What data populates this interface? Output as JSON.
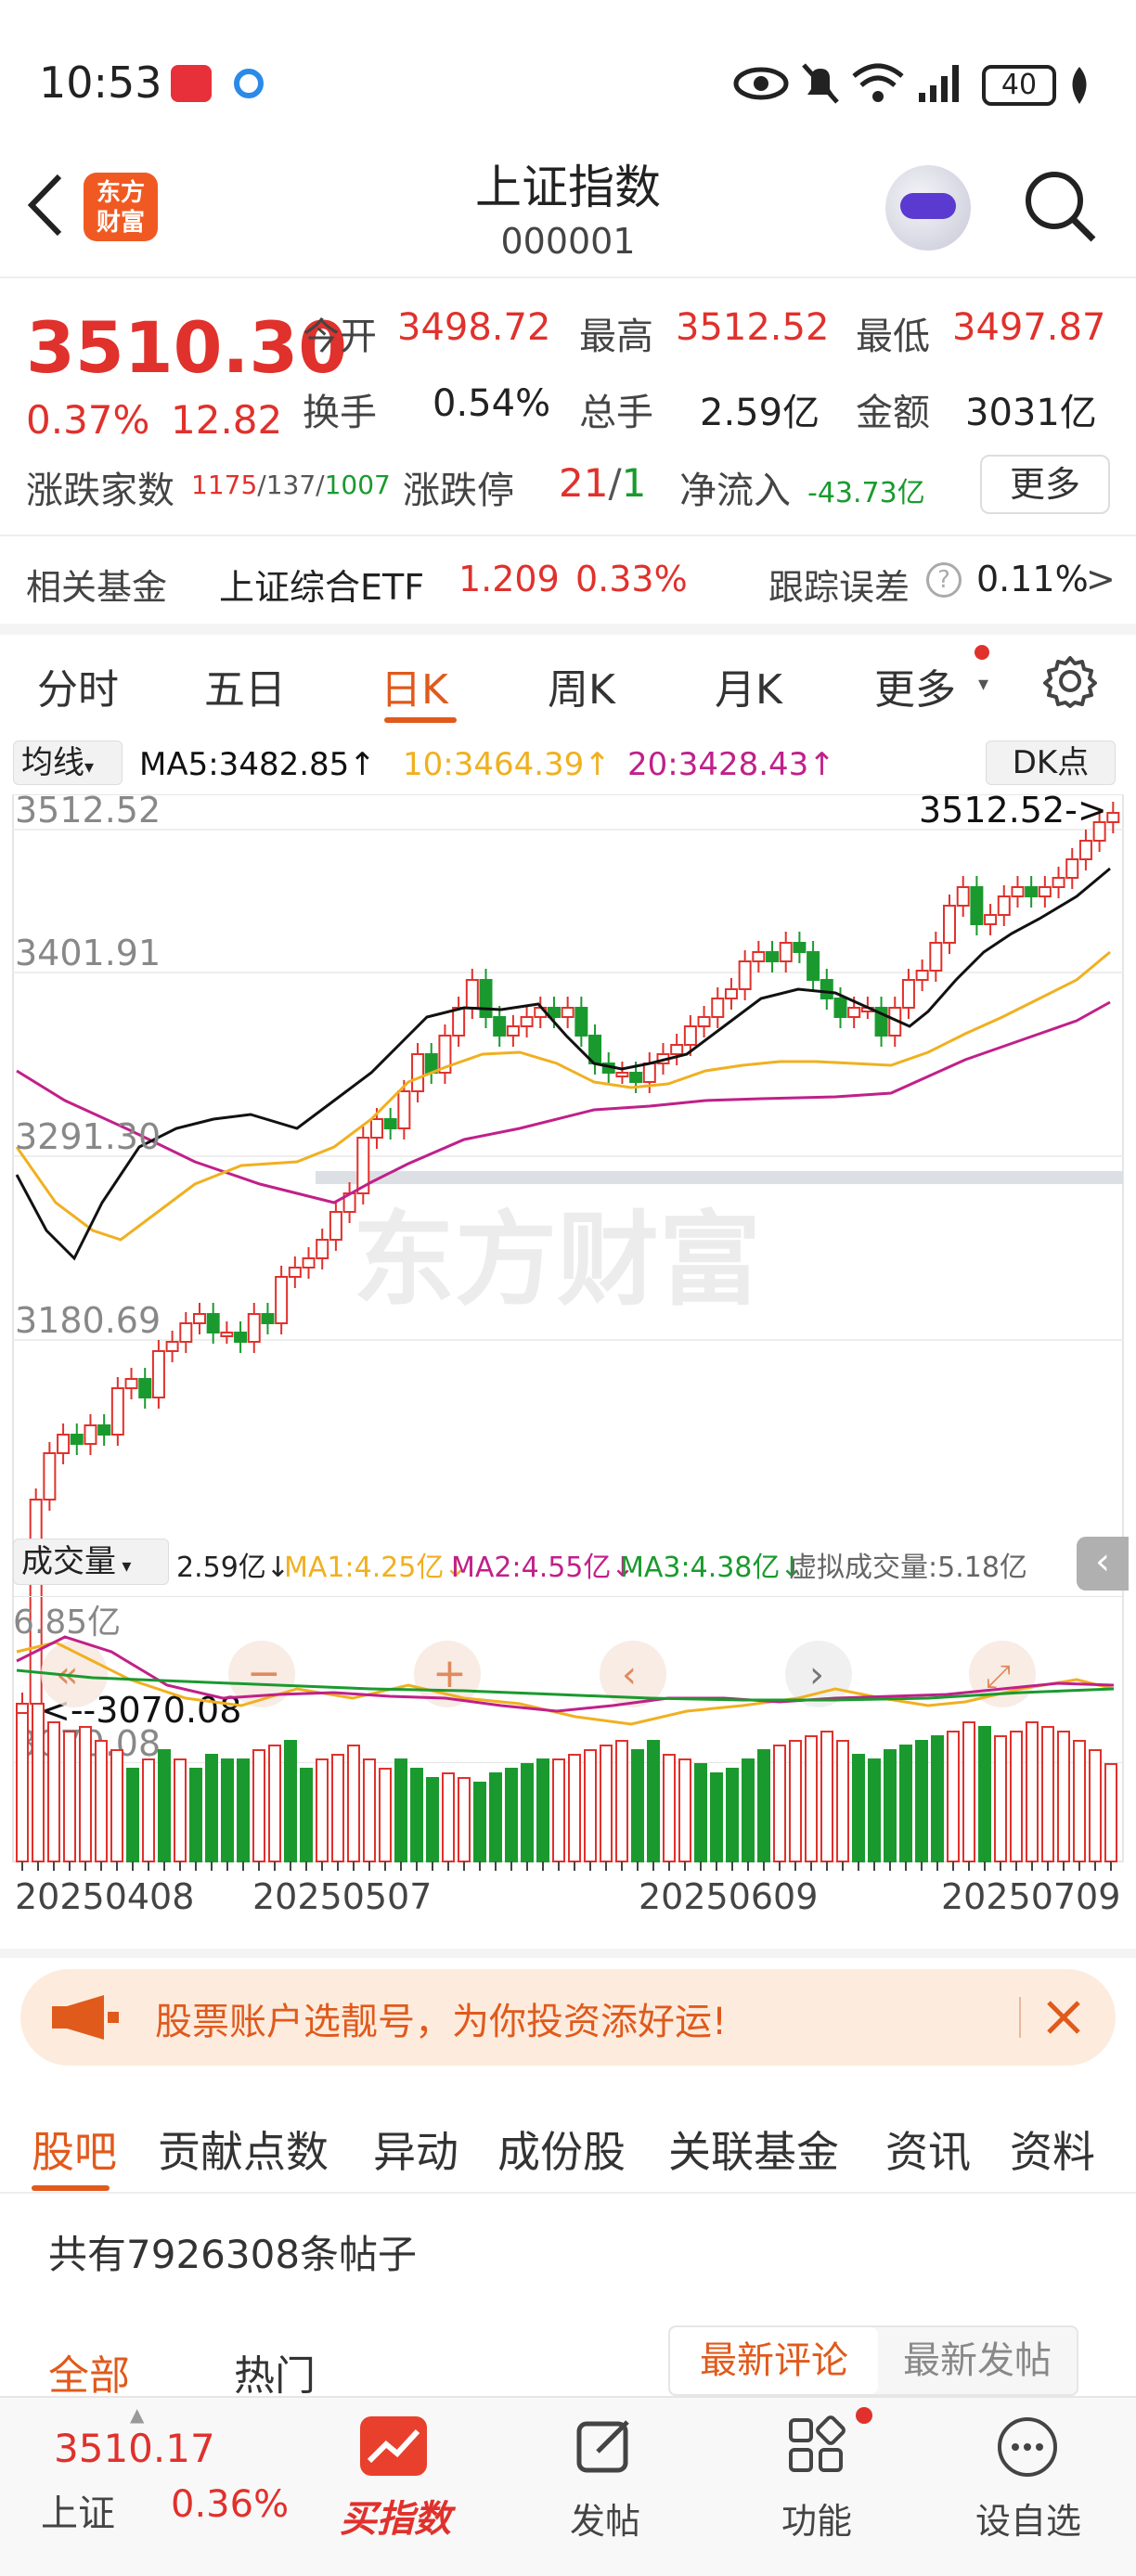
{
  "status_bar": {
    "time": "10:53",
    "battery": "40"
  },
  "header": {
    "title": "上证指数",
    "code": "000001",
    "logo_text": "东方财富"
  },
  "quote": {
    "price": "3510.30",
    "change_pct": "0.37%",
    "change_val": "12.82",
    "open_label": "今开",
    "open": "3498.72",
    "high_label": "最高",
    "high": "3512.52",
    "low_label": "最低",
    "low": "3497.87",
    "turnover_label": "换手",
    "turnover": "0.54%",
    "volume_label": "总手",
    "volume": "2.59亿",
    "amount_label": "金额",
    "amount": "3031亿",
    "breadth_label": "涨跌家数",
    "breadth_up": "1175",
    "breadth_flat": "137",
    "breadth_down": "1007",
    "limit_label": "涨跌停",
    "limit_up": "21",
    "limit_down": "1",
    "netflow_label": "净流入",
    "netflow": "-43.73亿",
    "more": "更多"
  },
  "fund": {
    "label": "相关基金",
    "name": "上证综合ETF",
    "price": "1.209",
    "pct": "0.33%",
    "tracking_label": "跟踪误差",
    "tracking": "0.11%",
    "arrow": ">"
  },
  "period_tabs": [
    "分时",
    "五日",
    "日K",
    "周K",
    "月K",
    "更多"
  ],
  "kline": {
    "ma_select": "均线",
    "ma5": "MA5:3482.85↑",
    "ma10": "10:3464.39↑",
    "ma20": "20:3428.43↑",
    "dk": "DK点",
    "y_labels": [
      "3512.52",
      "3401.91",
      "3291.30",
      "3180.69",
      "3070.08"
    ],
    "high_marker": "3512.52->",
    "low_marker": "<--3070.08",
    "watermark": "东方财富"
  },
  "volume": {
    "select": "成交量",
    "value": "2.59亿↓",
    "ma1": "MA1:4.25亿↓",
    "ma2": "MA2:4.55亿↓",
    "ma3": "MA3:4.38亿↓",
    "virtual": "虚拟成交量:5.18亿",
    "max_label": "6.85亿",
    "dates": [
      "20250408",
      "20250507",
      "20250609",
      "20250709"
    ]
  },
  "banner": {
    "text": "股票账户选靓号，为你投资添好运!"
  },
  "bottom_tabs": [
    "股吧",
    "贡献点数",
    "异动",
    "成份股",
    "关联基金",
    "资讯",
    "资料"
  ],
  "posts": {
    "count_text": "共有7926308条帖子",
    "filter_all": "全部",
    "filter_hot": "热门",
    "sort_latest_comment": "最新评论",
    "sort_latest_post": "最新发帖"
  },
  "navbar": {
    "index_price": "3510.17",
    "index_name": "上证",
    "index_pct": "0.36%",
    "buy_index": "买指数",
    "post": "发帖",
    "function": "功能",
    "add_watch": "设自选"
  },
  "colors": {
    "up": "#e0312c",
    "down": "#1a9a2e",
    "accent": "#e05a1c",
    "ma5": "#111111",
    "ma10": "#f0b020",
    "ma20": "#c0208a"
  }
}
